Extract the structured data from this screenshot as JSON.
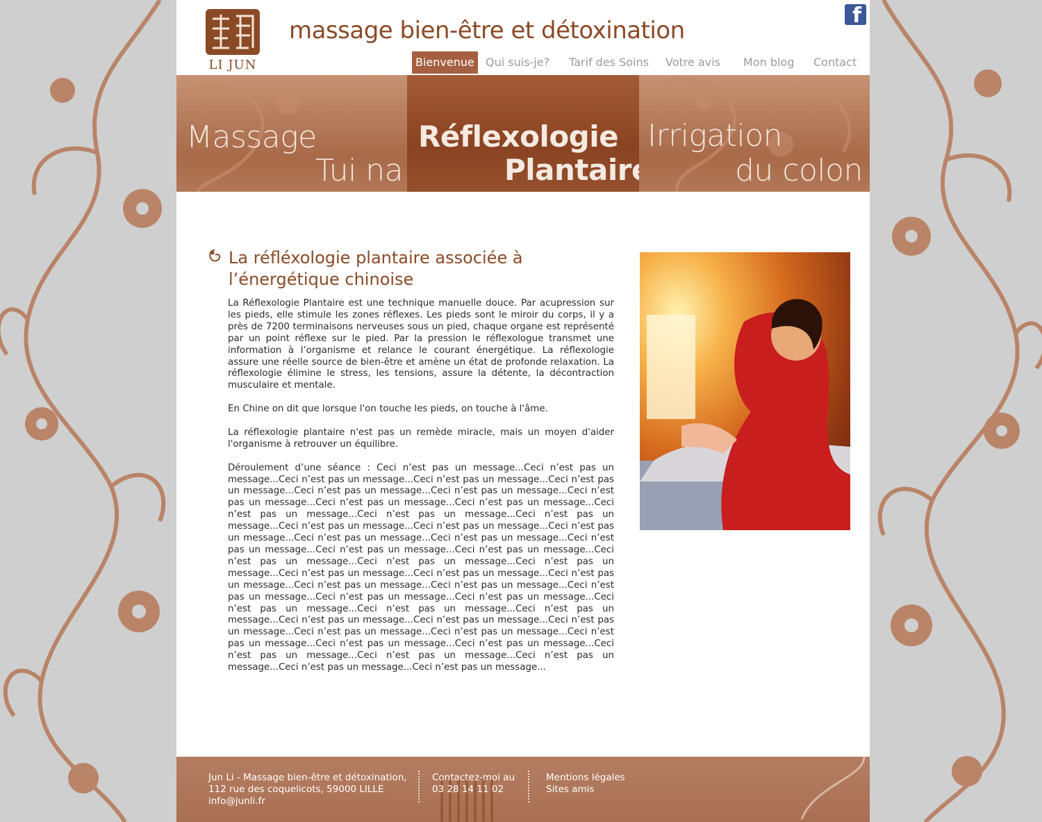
{
  "header": {
    "logo_text": "LI JUN",
    "site_title": "massage bien-être et détoxination",
    "facebook_label": "f"
  },
  "nav": {
    "items": [
      {
        "label": "Bienvenue",
        "active": true
      },
      {
        "label": "Qui suis-je?"
      },
      {
        "label": "Tarif des Soins"
      },
      {
        "label": "Votre avis"
      },
      {
        "label": "Mon blog"
      },
      {
        "label": "Contact"
      }
    ]
  },
  "banner": {
    "panels": [
      {
        "line1": "Massage",
        "line2": "Tui na"
      },
      {
        "line1": "Réflexologie",
        "line2": "Plantaire",
        "active": true
      },
      {
        "line1": "Irrigation",
        "line2": "du colon"
      }
    ]
  },
  "main": {
    "heading": "La réfléxologie plantaire associée à l’énergétique chinoise",
    "paragraphs": [
      "La Réflexologie Plantaire est une technique manuelle douce. Par acupression sur les pieds, elle stimule les zones réflexes. Les pieds sont le miroir du corps, il y a près de 7200 terminaisons nerveuses sous un pied, chaque organe est représenté par un point réflexe sur le pied. Par la pression le réflexologue transmet une information à l’organisme et relance le courant énergétique. La réflexologie assure une réelle source de bien-être et amène un état de profonde relaxation. La réflexologie élimine le stress, les tensions, assure la détente, la décontraction musculaire et mentale.",
      "En Chine on dit que lorsque l'on touche les pieds, on touche à l'âme.",
      "La réflexologie plantaire n'est pas un remède miracle, mais un moyen d'aider l'organisme à retrouver un équilibre.",
      "Déroulement d’une séance : Ceci n’est pas un message...Ceci n’est pas un message...Ceci n’est pas un message...Ceci n’est pas un message...Ceci n’est pas un message...Ceci n’est pas un message...Ceci n’est pas un message...Ceci n’est pas un message...Ceci n’est pas un message...Ceci n’est pas un message...Ceci n’est pas un message...Ceci n’est pas un message...Ceci n’est pas un message...Ceci n’est pas un message...Ceci n’est pas un message...Ceci n’est pas un message...Ceci n’est pas un message...Ceci n’est pas un message...Ceci n’est pas un message...Ceci n’est pas un message...Ceci n’est pas un message...Ceci n’est pas un message...Ceci n’est pas un message...Ceci n’est pas un message...Ceci n’est pas un message...Ceci n’est pas un message...Ceci n’est pas un message...Ceci n’est pas un message...Ceci n’est pas un message...Ceci n’est pas un message...Ceci n’est pas un message...Ceci n’est pas un message...Ceci n’est pas un message...Ceci n’est pas un message...Ceci n’est pas un message...Ceci n’est pas un message...Ceci n’est pas un message...Ceci n’est pas un message...Ceci n’est pas un message...Ceci n’est pas un message...Ceci n’est pas un message...Ceci n’est pas un message...Ceci n’est pas un message...Ceci n’est pas un message...Ceci n’est pas un message...Ceci n’est pas un message...Ceci n’est pas un message...Ceci n’est pas un message..."
    ]
  },
  "footer": {
    "address_line1": "Jun Li - Massage bien-être et détoxination,",
    "address_line2": "112 rue des coquelicots, 59000 LILLE",
    "email": "info@junli.fr",
    "contact_label": "Contactez-moi au",
    "phone": "03 28 14 11 02",
    "legal": "Mentions légales",
    "friends": "Sites amis"
  },
  "colors": {
    "brand_brown": "#8b4a26",
    "nav_active_bg": "#a46040",
    "background_grey": "#cfcfcf"
  }
}
